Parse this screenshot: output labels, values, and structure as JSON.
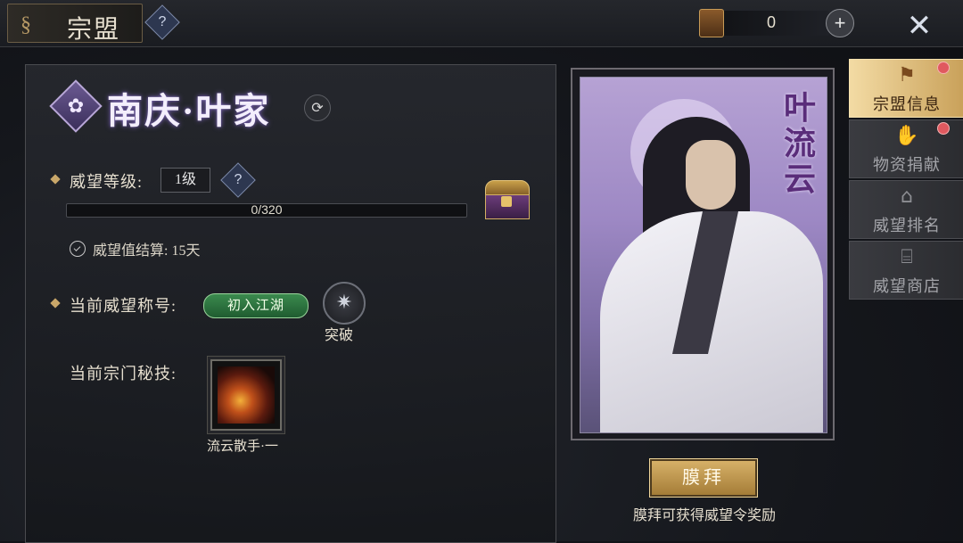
{
  "header": {
    "title": "宗盟",
    "help_label": "?",
    "currency_value": "0",
    "plus_label": "+"
  },
  "clan": {
    "name": "南庆·叶家",
    "prestige_level_label": "威望等级:",
    "prestige_level_value": "1级",
    "help_label": "?",
    "progress_text": "0/320",
    "progress_fraction": 0.0,
    "settlement_text": "威望值结算: 15天",
    "current_title_label": "当前威望称号:",
    "current_title_value": "初入江湖",
    "breakthrough_label": "突破",
    "secret_skill_label": "当前宗门秘技:",
    "secret_skill_name": "流云散手·一"
  },
  "portrait": {
    "name_vertical": "叶\n流\n云"
  },
  "worship": {
    "button_label": "膜拜",
    "tip": "膜拜可获得威望令奖励"
  },
  "side_tabs": [
    {
      "label": "宗盟信息",
      "icon": "banner-icon",
      "active": true,
      "red_dot": true
    },
    {
      "label": "物资捐献",
      "icon": "donate-icon",
      "active": false,
      "red_dot": true
    },
    {
      "label": "威望排名",
      "icon": "rank-icon",
      "active": false,
      "red_dot": false
    },
    {
      "label": "威望商店",
      "icon": "shop-icon",
      "active": false,
      "red_dot": false
    }
  ],
  "colors": {
    "accent_gold": "#c9a15a",
    "title_badge_green": "#3b8a4e",
    "red_dot": "#e0595f"
  }
}
